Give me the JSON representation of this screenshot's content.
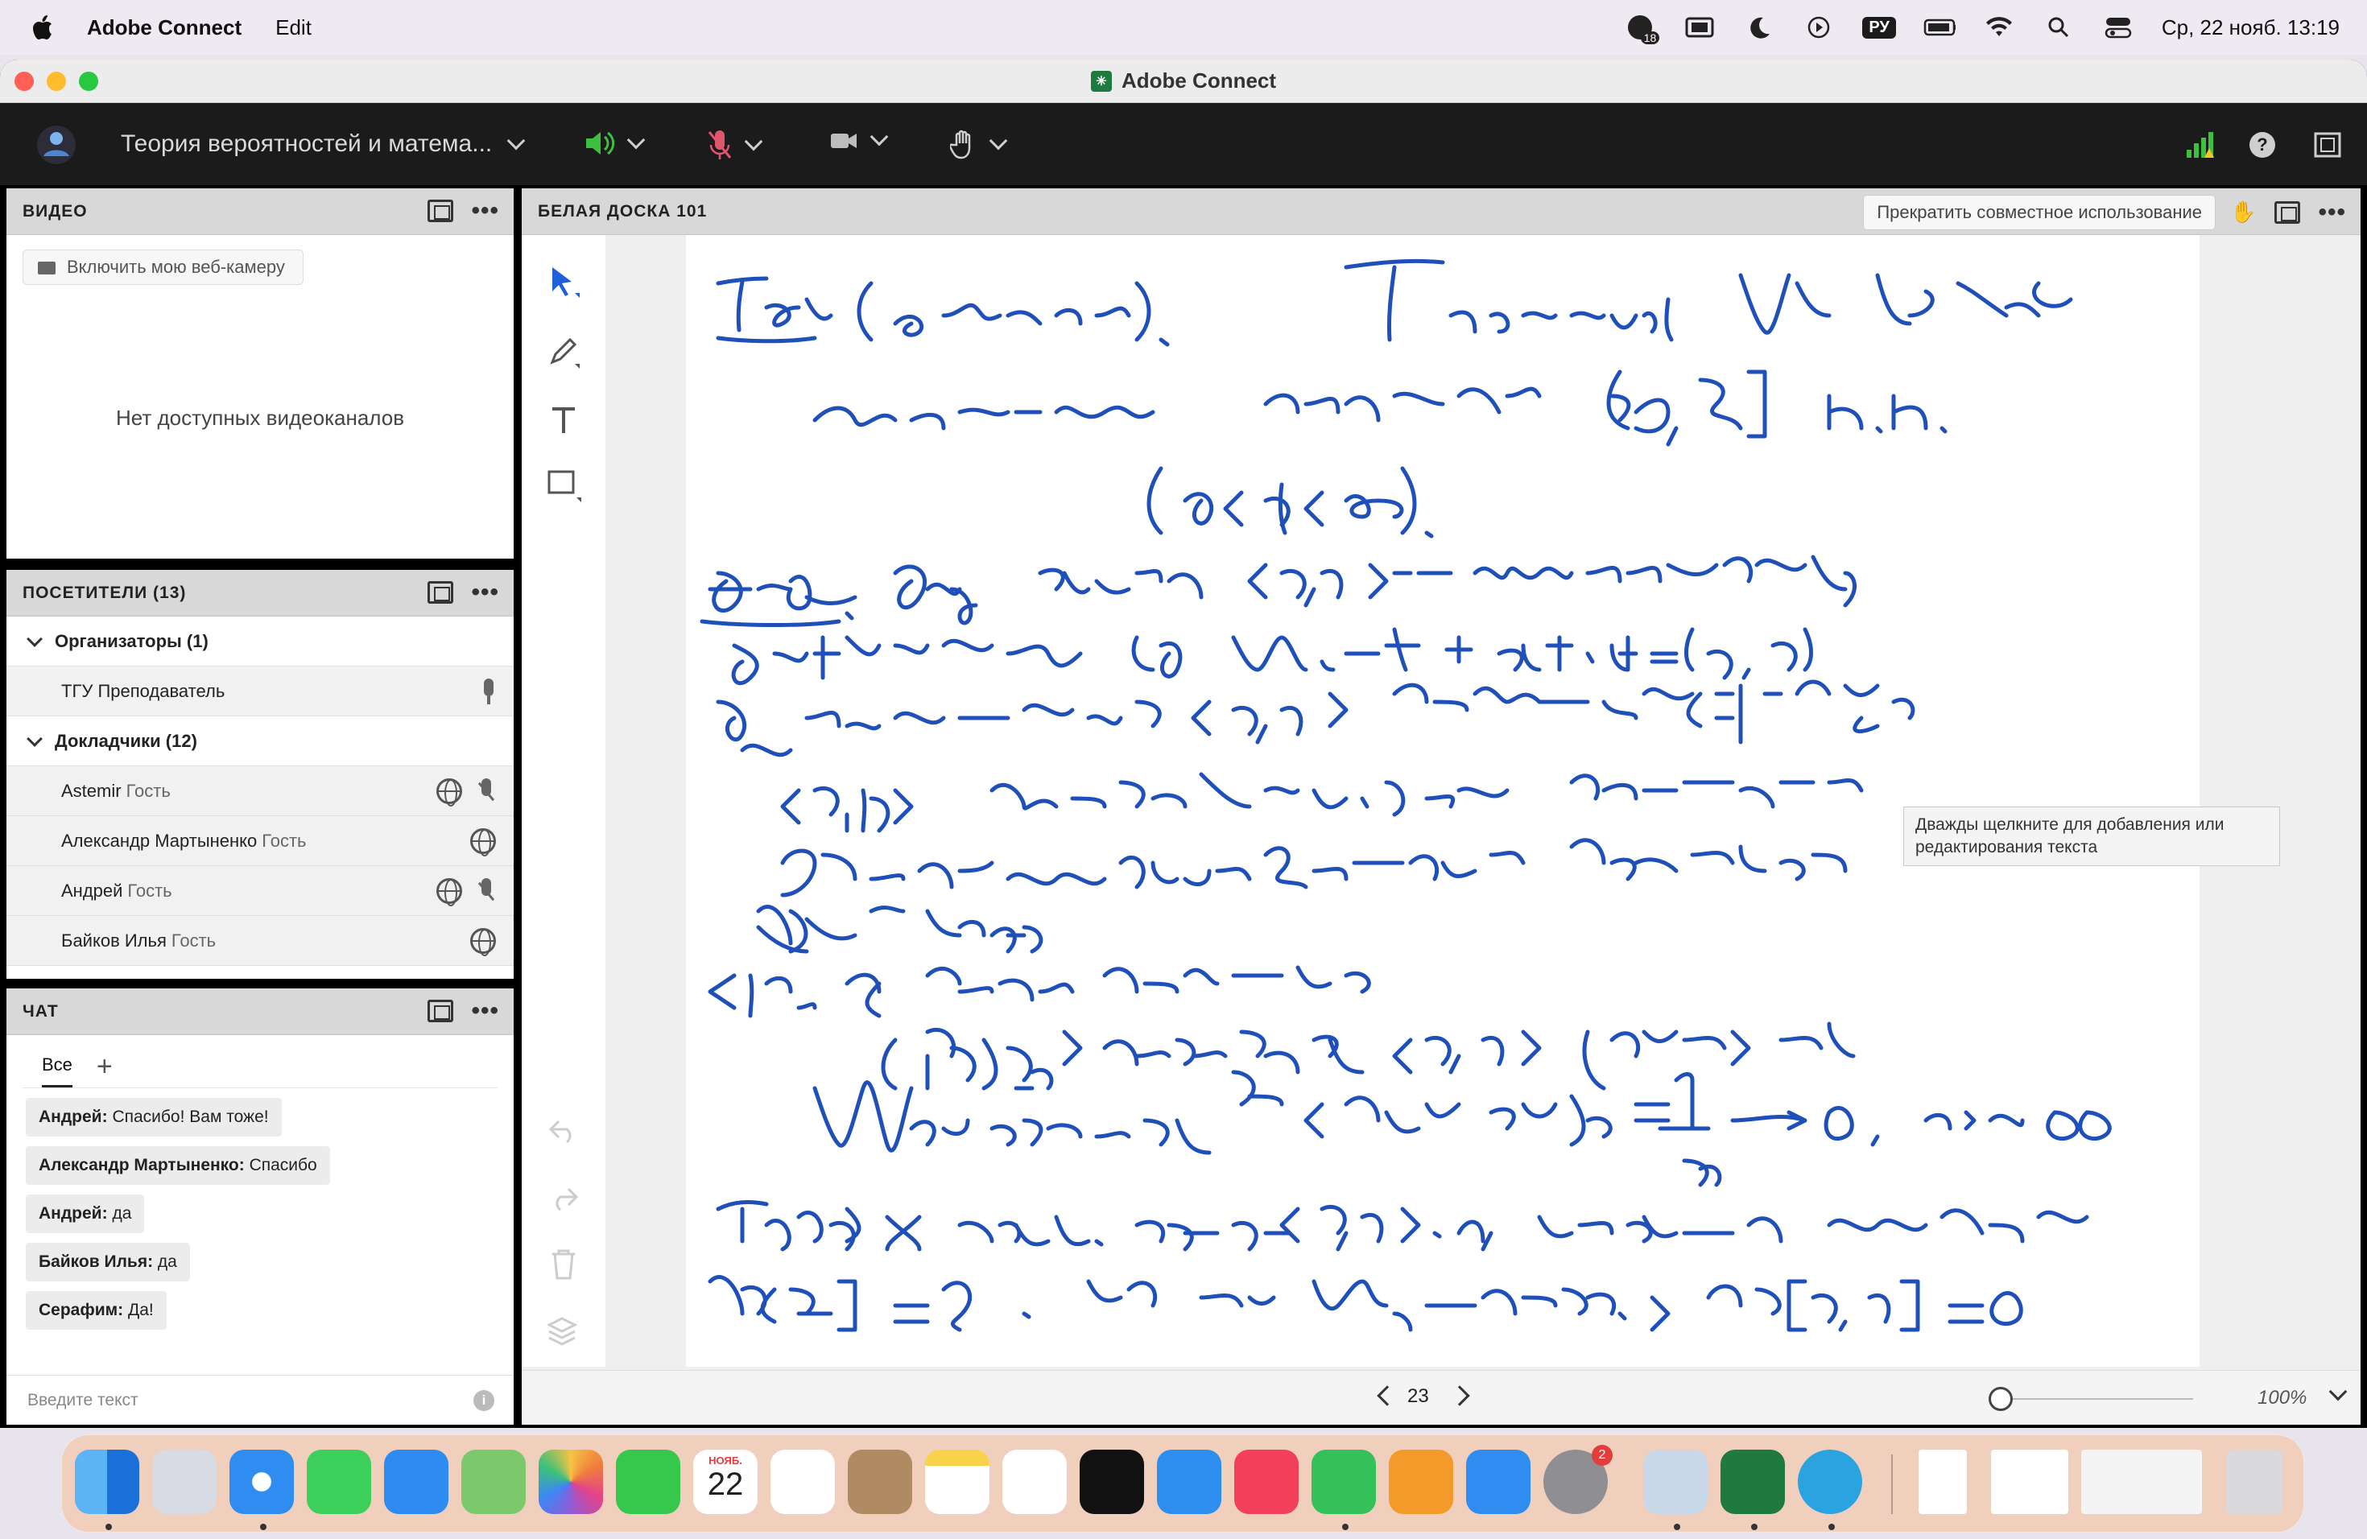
{
  "menubar": {
    "app_name": "Adobe Connect",
    "menu_edit": "Edit",
    "notification_count": "18",
    "input_source": "РУ",
    "datetime": "Ср, 22 нояб.  13:19"
  },
  "window": {
    "title": "Adobe Connect"
  },
  "appbar": {
    "meeting_title": "Теория вероятностей и матема..."
  },
  "video_pod": {
    "title": "ВИДЕО",
    "webcam_button": "Включить мою веб-камеру",
    "empty_text": "Нет доступных видеоканалов"
  },
  "attendees_pod": {
    "title": "ПОСЕТИТЕЛИ  (13)",
    "groups": [
      {
        "label": "Организаторы (1)"
      },
      {
        "label": "Докладчики (12)"
      }
    ],
    "hosts": [
      {
        "name": "ТГУ Преподаватель",
        "role": ""
      }
    ],
    "presenters": [
      {
        "name": "Astemir",
        "role": "Гость"
      },
      {
        "name": "Александр Мартыненко",
        "role": "Гость"
      },
      {
        "name": "Андрей",
        "role": "Гость"
      },
      {
        "name": "Байков Илья",
        "role": "Гость"
      }
    ]
  },
  "chat_pod": {
    "title": "ЧАТ",
    "tab_all": "Все",
    "tab_add": "+",
    "messages": [
      {
        "author": "Андрей:",
        "text": "Спасибо! Вам тоже!"
      },
      {
        "author": "Александр Мартыненко:",
        "text": "Спасибо"
      },
      {
        "author": "Андрей:",
        "text": "да"
      },
      {
        "author": "Байков Илья:",
        "text": "да"
      },
      {
        "author": "Серафим:",
        "text": "Да!"
      }
    ],
    "input_placeholder": "Введите текст"
  },
  "whiteboard_pod": {
    "title": "БЕЛАЯ ДОСКА 101",
    "stop_share_button": "Прекратить совместное использование",
    "tooltip": "Дважды щелкните для добавления или редактирования текста",
    "page_number": "23",
    "zoom": "100%"
  },
  "dock": {
    "calendar_month": "НОЯБ.",
    "calendar_day": "22",
    "settings_badge": "2"
  },
  "colors": {
    "ink": "#1f4fb8",
    "accent_green": "#3fbf3f",
    "mic_muted": "#e0566e",
    "appbar_bg": "#1b1b1b"
  }
}
